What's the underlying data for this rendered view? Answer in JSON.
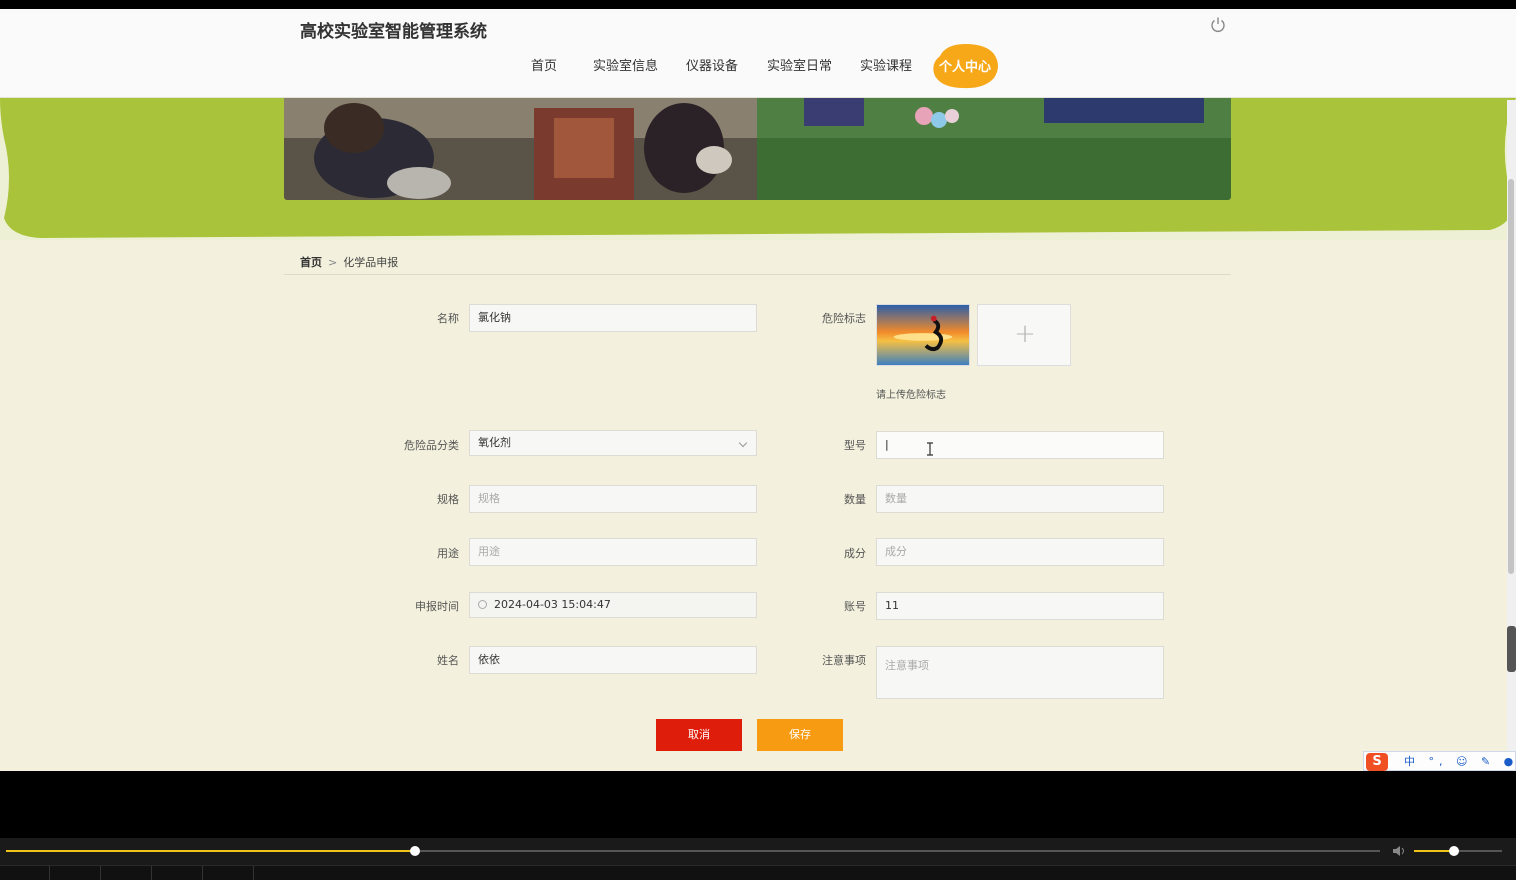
{
  "header": {
    "title": "高校实验室智能管理系统",
    "nav": [
      "首页",
      "实验室信息",
      "仪器设备",
      "实验室日常",
      "实验课程"
    ],
    "nav_active": "个人中心"
  },
  "breadcrumb": {
    "home": "首页",
    "separator": ">",
    "current": "化学品申报"
  },
  "form": {
    "name": {
      "label": "名称",
      "value": "氯化钠"
    },
    "hazard_sign": {
      "label": "危险标志",
      "hint": "请上传危险标志",
      "upload_symbol": "+"
    },
    "category": {
      "label": "危险品分类",
      "value": "氧化剂"
    },
    "model": {
      "label": "型号",
      "value": "|"
    },
    "spec": {
      "label": "规格",
      "placeholder": "规格"
    },
    "quantity": {
      "label": "数量",
      "placeholder": "数量"
    },
    "usage": {
      "label": "用途",
      "placeholder": "用途"
    },
    "composition": {
      "label": "成分",
      "placeholder": "成分"
    },
    "report_time": {
      "label": "申报时间",
      "value": "2024-04-03 15:04:47"
    },
    "account": {
      "label": "账号",
      "value": "11"
    },
    "person_name": {
      "label": "姓名",
      "value": "依依"
    },
    "notes": {
      "label": "注意事项",
      "placeholder": "注意事项"
    }
  },
  "buttons": {
    "cancel": "取消",
    "save": "保存"
  },
  "ime": {
    "logo": "S",
    "items": "中 °, ☺ ✎ ● ▦"
  },
  "player": {
    "seek_progress": 0.298,
    "volume": 0.45
  },
  "colors": {
    "banner_green": "#a9c43a",
    "cancel_red": "#de1d0b",
    "save_orange": "#f69b12",
    "active_nav": "#f7a818"
  }
}
